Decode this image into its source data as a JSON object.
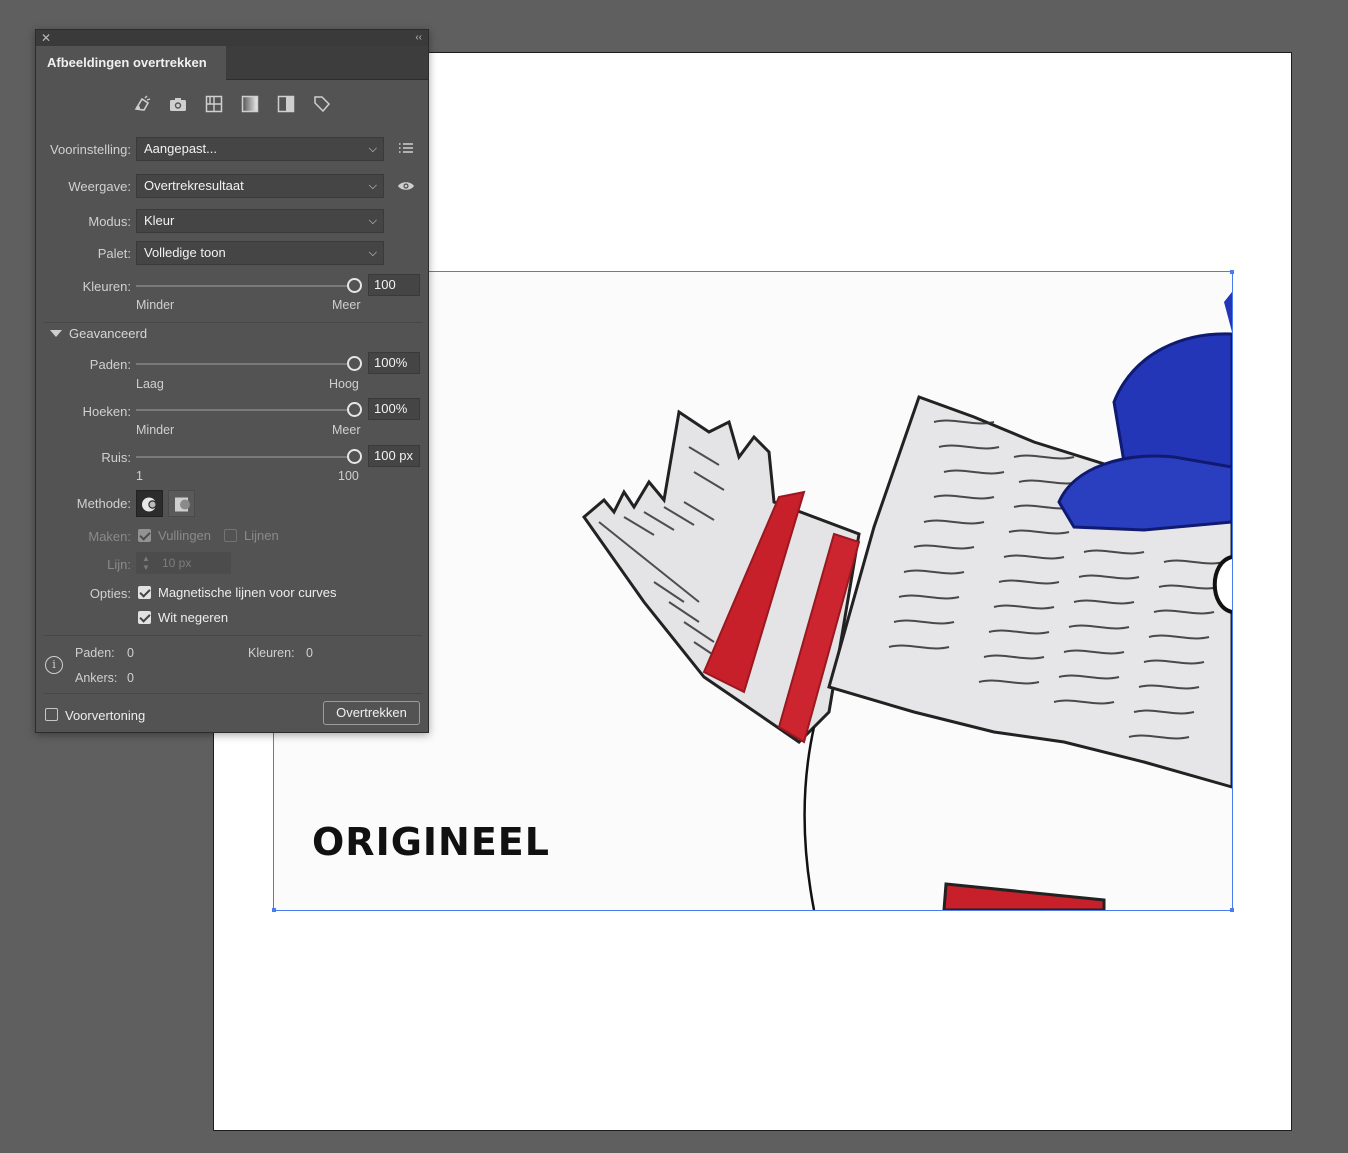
{
  "panel": {
    "tab_title": "Afbeeldingen overtrekken",
    "preset_icons": [
      "auto-color-icon",
      "high-color-photo-icon",
      "low-color-icon",
      "grayscale-icon",
      "black-white-icon",
      "outline-icon"
    ],
    "preset": {
      "label": "Voorinstelling:",
      "value": "Aangepast..."
    },
    "view": {
      "label": "Weergave:",
      "value": "Overtrekresultaat"
    },
    "mode": {
      "label": "Modus:",
      "value": "Kleur"
    },
    "palette": {
      "label": "Palet:",
      "value": "Volledige toon"
    },
    "colors": {
      "label": "Kleuren:",
      "value": "100",
      "min": "Minder",
      "max": "Meer",
      "level": 1.0
    },
    "advanced": {
      "label": "Geavanceerd"
    },
    "paths": {
      "label": "Paden:",
      "value": "100%",
      "min": "Laag",
      "max": "Hoog",
      "level": 1.0
    },
    "corners": {
      "label": "Hoeken:",
      "value": "100%",
      "min": "Minder",
      "max": "Meer",
      "level": 1.0
    },
    "noise": {
      "label": "Ruis:",
      "value": "100 px",
      "min": "1",
      "max": "100",
      "level": 1.0
    },
    "method": {
      "label": "Methode:"
    },
    "create": {
      "label": "Maken:",
      "fills": "Vullingen",
      "strokes": "Lijnen",
      "fills_checked": true,
      "strokes_checked": false
    },
    "stroke": {
      "label": "Lijn:",
      "value": "10 px"
    },
    "options": {
      "label": "Opties:",
      "snap_curves": "Magnetische lijnen voor curves",
      "ignore_white": "Wit negeren",
      "snap_checked": true,
      "ignore_checked": true
    },
    "stats": {
      "paths_label": "Paden:",
      "paths_value": "0",
      "colors_label": "Kleuren:",
      "colors_value": "0",
      "anchors_label": "Ankers:",
      "anchors_value": "0"
    },
    "preview": {
      "label": "Voorvertoning",
      "checked": false
    },
    "trace_button": "Overtrekken"
  },
  "canvas": {
    "image_caption": "ORIGINEEL",
    "selection_color": "#4a7cf0"
  }
}
